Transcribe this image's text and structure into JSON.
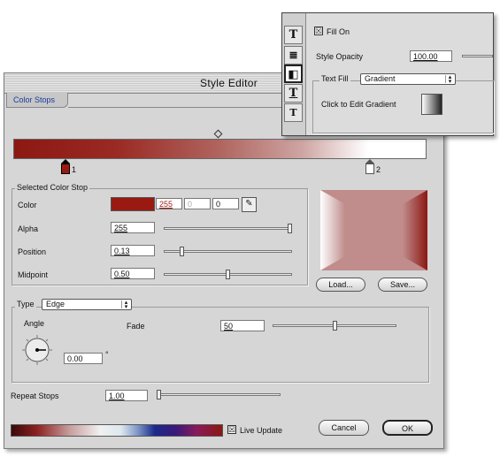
{
  "window": {
    "title": "Style Editor"
  },
  "tab": {
    "label": "Color Stops"
  },
  "gradient": {
    "stops": [
      {
        "label": "1"
      },
      {
        "label": "2"
      }
    ]
  },
  "selected_stop": {
    "group_title": "Selected Color Stop",
    "color_label": "Color",
    "color_swatch": "#9a1a12",
    "r": "255",
    "g": "0",
    "b": "0",
    "alpha_label": "Alpha",
    "alpha_value": "255",
    "alpha_level": 1.0,
    "position_label": "Position",
    "position_value": "0.13",
    "position_level": 0.13,
    "midpoint_label": "Midpoint",
    "midpoint_value": "0.50",
    "midpoint_level": 0.5
  },
  "buttons": {
    "load": "Load...",
    "save": "Save...",
    "cancel": "Cancel",
    "ok": "OK"
  },
  "type_group": {
    "type_label": "Type",
    "type_value": "Edge",
    "angle_label": "Angle",
    "angle_value": "0.00",
    "degree_symbol": "°",
    "fade_label": "Fade",
    "fade_value": "50",
    "fade_level": 0.5
  },
  "repeat": {
    "label": "Repeat Stops",
    "value": "1.00",
    "level": 0.0
  },
  "live_update": {
    "label": "Live Update",
    "checked": "☒"
  },
  "panel": {
    "fill_on_label": "Fill On",
    "fill_on_checked": "☒",
    "style_opacity_label": "Style Opacity",
    "style_opacity_value": "100.00",
    "text_fill_label": "Text Fill",
    "text_fill_value": "Gradient",
    "edit_gradient_label": "Click to Edit Gradient",
    "tab_icons": [
      "T",
      "≣",
      "◧",
      "T",
      "T"
    ]
  },
  "colors": {
    "accent_red": "#8c1812",
    "preview_pink": "#c08c8c"
  }
}
